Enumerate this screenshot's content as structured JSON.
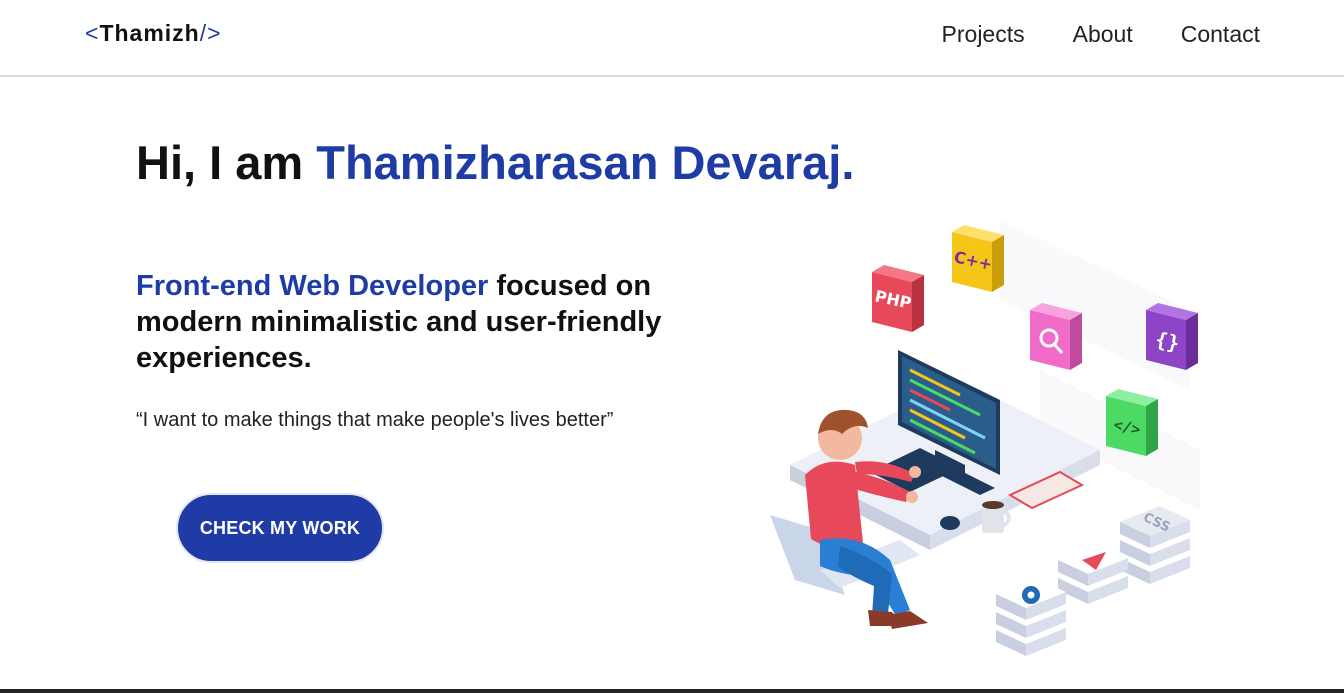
{
  "nav": {
    "logo": {
      "open": "<",
      "name": "Thamizh",
      "close": "/>"
    },
    "links": [
      "Projects",
      "About",
      "Contact"
    ]
  },
  "hero": {
    "greeting_prefix": "Hi, I am ",
    "name": "Thamizharasan Devaraj.",
    "role": "Front-end Web Developer",
    "tagline_rest": " focused on modern minimalistic and user-friendly experiences.",
    "quote": "“I want to make things that make people's lives better”",
    "cta_label": "CHECK MY WORK"
  },
  "illustration": {
    "tiles": [
      "PHP",
      "C++",
      "{}",
      "</>",
      "CSS"
    ]
  },
  "colors": {
    "accent": "#1f3ca6",
    "php": "#e8495a",
    "cpp": "#f5c518",
    "search": "#f06cc8",
    "braces": "#8e44c7",
    "code": "#4cd964"
  }
}
